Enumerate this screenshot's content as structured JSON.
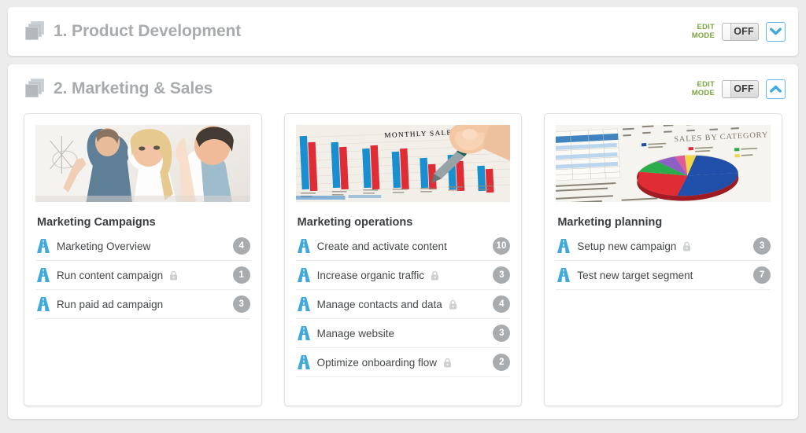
{
  "sections": [
    {
      "title": "1. Product Development",
      "icon": "stacked-pages-icon",
      "edit_mode_line1": "EDIT",
      "edit_mode_line2": "MODE",
      "toggle_value": "OFF",
      "collapse_icon": "chevron-down-icon",
      "expanded": false,
      "cards": []
    },
    {
      "title": "2. Marketing & Sales",
      "icon": "stacked-pages-icon",
      "edit_mode_line1": "EDIT",
      "edit_mode_line2": "MODE",
      "toggle_value": "OFF",
      "collapse_icon": "chevron-up-icon",
      "expanded": true,
      "cards": [
        {
          "title": "Marketing Campaigns",
          "image": "business-team-whiteboard-photo",
          "image_caption": "",
          "items": [
            {
              "label": "Marketing Overview",
              "locked": false,
              "badge": "4"
            },
            {
              "label": "Run content campaign",
              "locked": true,
              "badge": "1"
            },
            {
              "label": "Run paid ad campaign",
              "locked": false,
              "badge": "3"
            }
          ]
        },
        {
          "title": "Marketing operations",
          "image": "monthly-sales-bar-chart-photo",
          "image_caption": "MONTHLY SALES",
          "items": [
            {
              "label": "Create and activate content",
              "locked": false,
              "badge": "10"
            },
            {
              "label": "Increase organic traffic",
              "locked": true,
              "badge": "3"
            },
            {
              "label": "Manage contacts and data",
              "locked": true,
              "badge": "4"
            },
            {
              "label": "Manage website",
              "locked": false,
              "badge": "3"
            },
            {
              "label": "Optimize onboarding flow",
              "locked": true,
              "badge": "2"
            }
          ]
        },
        {
          "title": "Marketing planning",
          "image": "sales-by-category-pie-chart-photo",
          "image_caption": "SALES BY CATEGORY",
          "items": [
            {
              "label": "Setup new campaign",
              "locked": true,
              "badge": "3"
            },
            {
              "label": "Test new target segment",
              "locked": false,
              "badge": "7"
            }
          ]
        }
      ]
    }
  ],
  "colors": {
    "accent_blue": "#3fa9dd",
    "edit_mode_green": "#7aa640",
    "badge_grey": "#a9acae",
    "title_grey": "#a8abad",
    "page_bg": "#ececec"
  }
}
